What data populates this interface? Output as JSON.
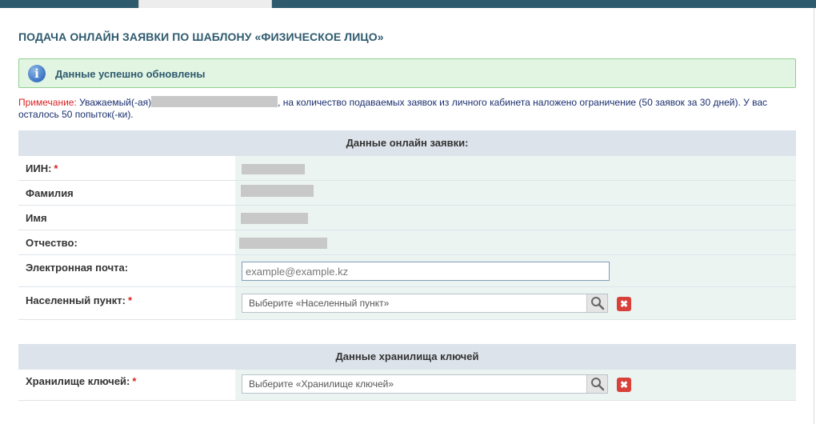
{
  "page": {
    "title": "ПОДАЧА ОНЛАЙН ЗАЯВКИ ПО ШАБЛОНУ «ФИЗИЧЕСКОЕ ЛИЦО»"
  },
  "alert": {
    "message": "Данные успешно обновлены",
    "icon": "info-icon",
    "icon_glyph": "i"
  },
  "note": {
    "label": "Примечание:",
    "text_before": "Уважаемый(-ая)",
    "text_after": ", на количество подаваемых заявок из личного кабинета наложено ограничение (50 заявок за 30 дней). У вас осталось 50 попыток(-ки)."
  },
  "application_section": {
    "title": "Данные онлайн заявки:",
    "iin_label": "ИИН:",
    "surname_label": "Фамилия",
    "name_label": "Имя",
    "patronymic_label": "Отчество:",
    "email_label": "Электронная почта:",
    "email_placeholder": "example@example.kz",
    "locality_label": "Населенный пункт:",
    "locality_placeholder": "Выберите «Населенный пункт»"
  },
  "keystore_section": {
    "title": "Данные хранилища ключей",
    "keystore_label": "Хранилище ключей:",
    "keystore_placeholder": "Выберите «Хранилище ключей»"
  },
  "required_mark": "*",
  "clear_glyph": "✖",
  "colors": {
    "accent": "#2e5a6e",
    "success_bg": "#e2f5e2",
    "required": "#dd2222",
    "clear_button": "#d9403a"
  }
}
